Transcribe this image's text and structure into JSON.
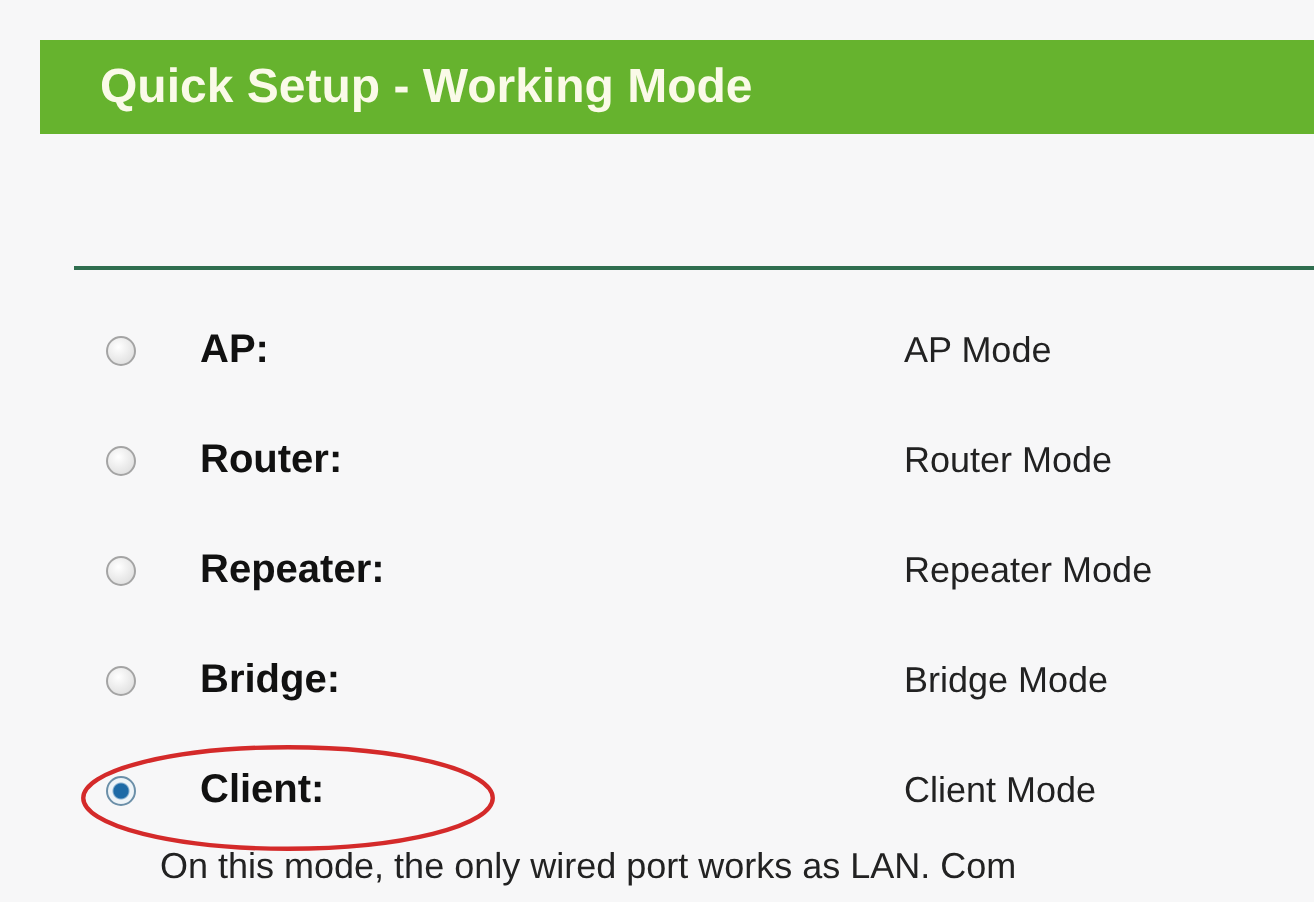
{
  "header": {
    "title": "Quick Setup - Working Mode"
  },
  "modes": [
    {
      "label": "AP:",
      "description": "AP Mode",
      "selected": false,
      "highlighted": false
    },
    {
      "label": "Router:",
      "description": "Router Mode",
      "selected": false,
      "highlighted": false
    },
    {
      "label": "Repeater:",
      "description": "Repeater Mode",
      "selected": false,
      "highlighted": false
    },
    {
      "label": "Bridge:",
      "description": "Bridge Mode",
      "selected": false,
      "highlighted": false
    },
    {
      "label": "Client:",
      "description": "Client Mode",
      "selected": true,
      "highlighted": true
    }
  ],
  "note": "On this mode, the only wired port works as LAN. Com"
}
